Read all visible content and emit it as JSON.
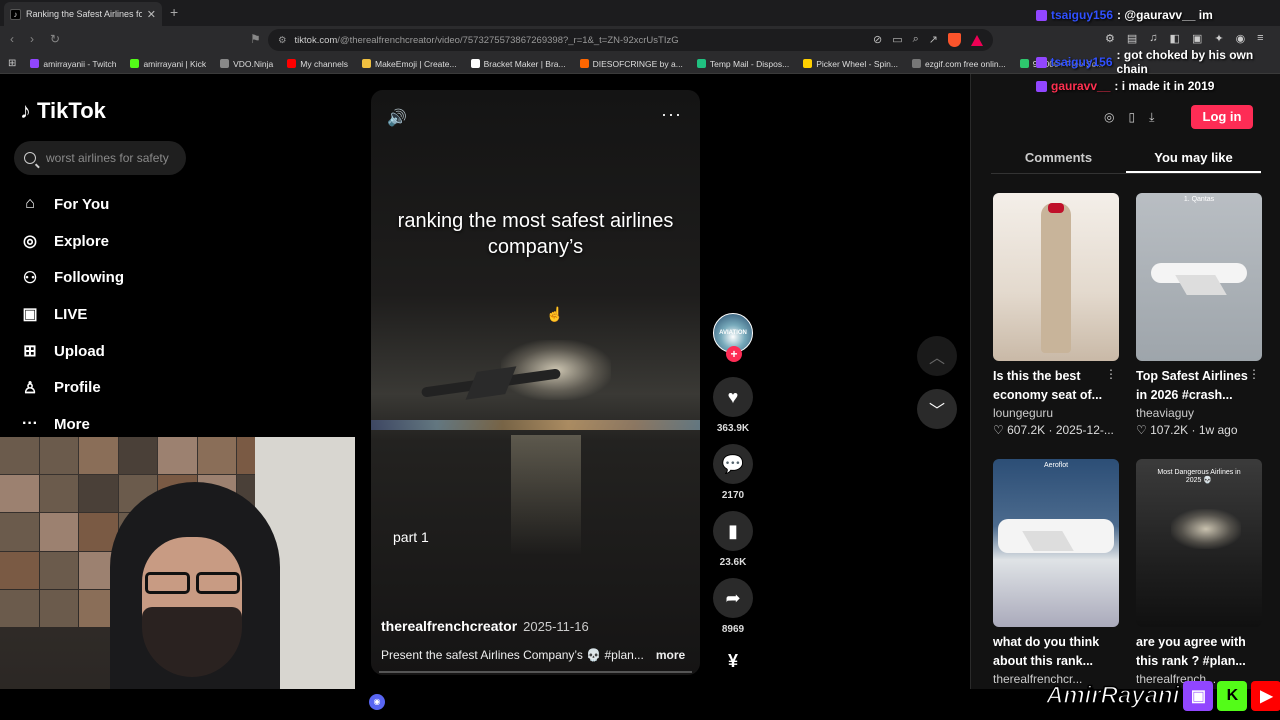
{
  "browser": {
    "tab_title": "Ranking the Safest Airlines fo",
    "url_domain": "tiktok.com",
    "url_path": "/@therealfrenchcreator/video/7573275573867269398?_r=1&_t=ZN-92xcrUsTIzG",
    "bookmarks": [
      {
        "label": "amirrayanii - Twitch",
        "color": "#9146ff"
      },
      {
        "label": "amirrayani | Kick",
        "color": "#53fc18"
      },
      {
        "label": "VDO.Ninja",
        "color": "#888888"
      },
      {
        "label": "My channels",
        "color": "#ff0000"
      },
      {
        "label": "MakeEmoji | Create...",
        "color": "#f0c040"
      },
      {
        "label": "Bracket Maker | Bra...",
        "color": "#ffffff"
      },
      {
        "label": "DIESOFCRINGE by a...",
        "color": "#ff6600"
      },
      {
        "label": "Temp Mail - Dispos...",
        "color": "#20c080"
      },
      {
        "label": "Picker Wheel - Spin...",
        "color": "#ffd000"
      },
      {
        "label": "ezgif.com free onlin...",
        "color": "#777777"
      },
      {
        "label": "90,000+ Free So...",
        "color": "#2ec66d"
      }
    ]
  },
  "tiktok": {
    "logo": "TikTok",
    "search_placeholder": "worst airlines for safety",
    "nav": [
      {
        "label": "For You",
        "icon": "home-icon",
        "glyph": "⌂"
      },
      {
        "label": "Explore",
        "icon": "compass-icon",
        "glyph": "◎"
      },
      {
        "label": "Following",
        "icon": "following-icon",
        "glyph": "⚇"
      },
      {
        "label": "LIVE",
        "icon": "live-icon",
        "glyph": "▣"
      },
      {
        "label": "Upload",
        "icon": "upload-icon",
        "glyph": "⊞"
      },
      {
        "label": "Profile",
        "icon": "profile-icon",
        "glyph": "♙"
      },
      {
        "label": "More",
        "icon": "more-icon",
        "glyph": "···"
      }
    ]
  },
  "video": {
    "caption": "ranking the most safest airlines company’s",
    "part_label": "part 1",
    "author": "therealfrenchcreator",
    "date": "2025-11-16",
    "description": "Present the safest Airlines Company’s 💀 #plan...",
    "more_label": "more",
    "avatar_text": "AVIATION",
    "likes": "363.9K",
    "comments": "2170",
    "saves": "23.6K",
    "shares": "8969"
  },
  "right_panel": {
    "login_label": "Log in",
    "tabs": [
      "Comments",
      "You may like"
    ],
    "active_tab": 1,
    "cards": [
      {
        "title": "Is this the best economy seat of...",
        "user": "loungeguru",
        "likes": "607.2K",
        "date": "2025-12-...",
        "thumb_text": ""
      },
      {
        "title": "Top Safest Airlines in 2026 #crash...",
        "user": "theaviaguy",
        "likes": "107.2K",
        "date": "1w ago",
        "thumb_text": "1. Qantas"
      },
      {
        "title": "what do you think about this rank...",
        "user": "therealfrenchcr...",
        "likes": "",
        "date": "",
        "thumb_text": "Aeroflot"
      },
      {
        "title": "are you agree with this rank ? #plan...",
        "user": "therealfrench...",
        "likes": "",
        "date": "",
        "thumb_text": "Most Dangerous Airlines in 2025 💀"
      }
    ]
  },
  "chat": [
    {
      "name": "tsaiguy156",
      "text": ": @gauravv__ im",
      "name_color": "#3050ff"
    },
    {
      "name": "tsaiguy156",
      "text": ": got choked by his own chain",
      "name_color": "#3050ff"
    },
    {
      "name": "gauravv__",
      "text": ": i made it in 2019",
      "name_color": "#ff3050"
    }
  ],
  "stream_banner": {
    "name": "AmirRayani"
  }
}
